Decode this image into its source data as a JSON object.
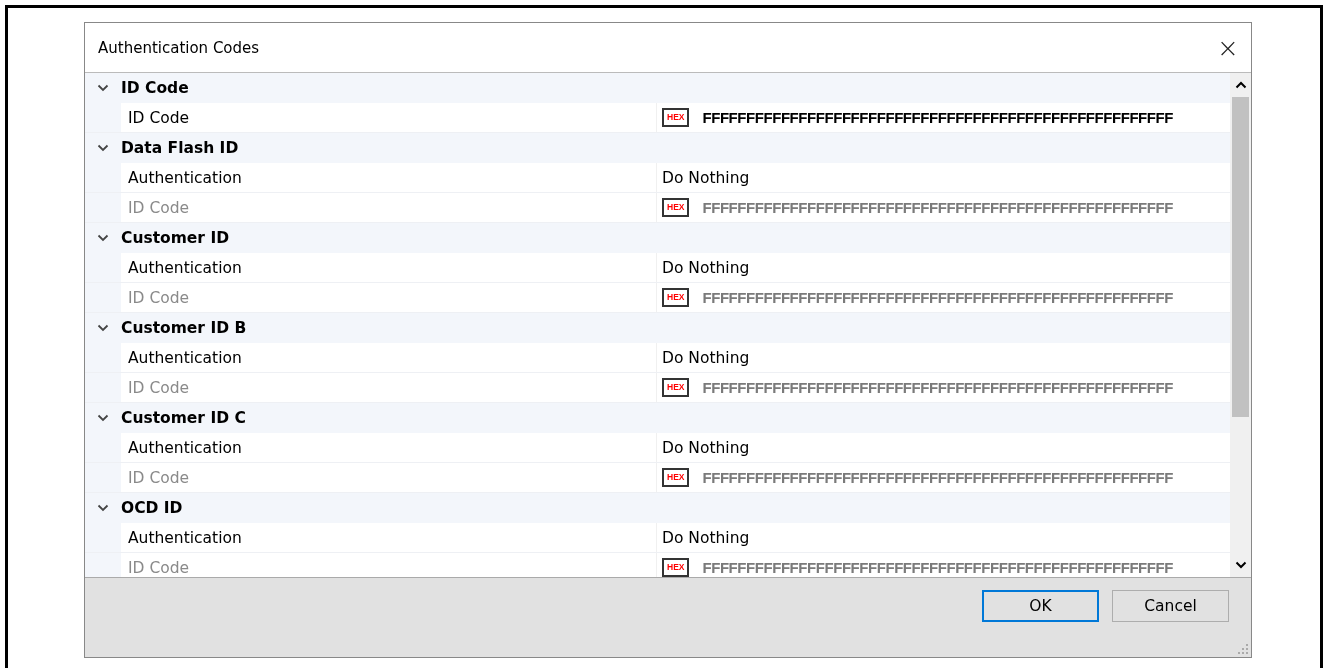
{
  "dialog": {
    "title": "Authentication Codes",
    "close": "×"
  },
  "groups": [
    {
      "name": "ID Code",
      "expanded": true,
      "properties": [
        {
          "kind": "hex",
          "label": "ID Code",
          "badge": "HEX",
          "value": "FFFFFFFFFFFFFFFFFFFFFFFFFFFFFFFFFFFFFFFFFFFFFFFFFFFFFF",
          "disabled": false
        }
      ]
    },
    {
      "name": "Data Flash ID",
      "expanded": true,
      "properties": [
        {
          "kind": "text",
          "label": "Authentication",
          "value": "Do Nothing",
          "disabled": false
        },
        {
          "kind": "hex",
          "label": "ID Code",
          "badge": "HEX",
          "value": "FFFFFFFFFFFFFFFFFFFFFFFFFFFFFFFFFFFFFFFFFFFFFFFFFFFFFF",
          "disabled": true
        }
      ]
    },
    {
      "name": "Customer ID",
      "expanded": true,
      "properties": [
        {
          "kind": "text",
          "label": "Authentication",
          "value": "Do Nothing",
          "disabled": false
        },
        {
          "kind": "hex",
          "label": "ID Code",
          "badge": "HEX",
          "value": "FFFFFFFFFFFFFFFFFFFFFFFFFFFFFFFFFFFFFFFFFFFFFFFFFFFFFF",
          "disabled": true
        }
      ]
    },
    {
      "name": "Customer ID B",
      "expanded": true,
      "properties": [
        {
          "kind": "text",
          "label": "Authentication",
          "value": "Do Nothing",
          "disabled": false
        },
        {
          "kind": "hex",
          "label": "ID Code",
          "badge": "HEX",
          "value": "FFFFFFFFFFFFFFFFFFFFFFFFFFFFFFFFFFFFFFFFFFFFFFFFFFFFFF",
          "disabled": true
        }
      ]
    },
    {
      "name": "Customer ID C",
      "expanded": true,
      "properties": [
        {
          "kind": "text",
          "label": "Authentication",
          "value": "Do Nothing",
          "disabled": false
        },
        {
          "kind": "hex",
          "label": "ID Code",
          "badge": "HEX",
          "value": "FFFFFFFFFFFFFFFFFFFFFFFFFFFFFFFFFFFFFFFFFFFFFFFFFFFFFF",
          "disabled": true
        }
      ]
    },
    {
      "name": "OCD ID",
      "expanded": true,
      "properties": [
        {
          "kind": "text",
          "label": "Authentication",
          "value": "Do Nothing",
          "disabled": false
        },
        {
          "kind": "hex",
          "label": "ID Code",
          "badge": "HEX",
          "value": "FFFFFFFFFFFFFFFFFFFFFFFFFFFFFFFFFFFFFFFFFFFFFFFFFFFFFF",
          "disabled": true
        }
      ]
    }
  ],
  "buttons": [
    {
      "label": "OK",
      "default": true
    },
    {
      "label": "Cancel",
      "default": false
    }
  ]
}
